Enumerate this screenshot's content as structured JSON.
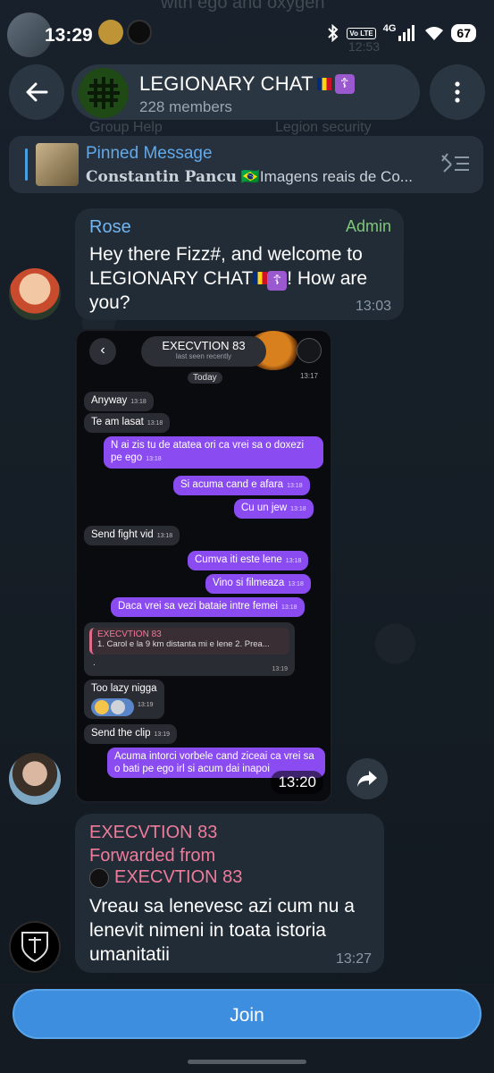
{
  "status_bar": {
    "time": "13:29",
    "battery": "67",
    "network": "4G",
    "volte": "Vo LTE"
  },
  "ghost": {
    "top_text": "with ego and oxygen",
    "top_time": "12:53",
    "group_help": "Group Help",
    "legion_security": "Legion security"
  },
  "header": {
    "title": "LEGIONARY CHAT",
    "members": "228 members",
    "cross_glyph": "☦"
  },
  "pinned": {
    "title": "Pinned Message",
    "author": "Constantin Pancu",
    "preview": "🇧🇷Imagens reais de Co..."
  },
  "messages": {
    "rose": {
      "sender": "Rose",
      "role": "Admin",
      "text_1": "Hey there Fizz#, and welcome to LEGIONARY CHAT",
      "text_2": "! How are you?",
      "time": "13:03"
    },
    "screenshot": {
      "time": "13:20",
      "inner": {
        "contact": "EXECVTION 83",
        "status": "last seen recently",
        "day": "Today",
        "top_time": "13:17",
        "msgs": [
          {
            "text": "Anyway",
            "time": "13:18"
          },
          {
            "text": "Te am lasat",
            "time": "13:18"
          },
          {
            "text": "N ai zis tu de atatea ori ca vrei sa o doxezi pe ego",
            "time": "13:18"
          },
          {
            "text": "Si acuma cand e afara",
            "time": "13:18"
          },
          {
            "text": "Cu un jew",
            "time": "13:18"
          },
          {
            "text": "Send fight vid",
            "time": "13:18"
          },
          {
            "text": "Cumva iti este lene",
            "time": "13:18"
          },
          {
            "text": "Vino si filmeaza",
            "time": "13:18"
          },
          {
            "text": "Daca vrei sa vezi bataie intre femei",
            "time": "13:18"
          },
          {
            "text": "Too lazy nigga",
            "time": "13:19"
          },
          {
            "text": "Send the clip",
            "time": "13:19"
          },
          {
            "text": "Acuma intorci vorbele cand ziceai ca vrei sa o bati pe ego irl si acum dai inapoi",
            "time": ""
          }
        ],
        "reply": {
          "name": "EXECVTION 83",
          "text": "1. Carol e la 9 km distanta mi e lene 2. Prea...",
          "body": ".",
          "time": "13:19"
        }
      }
    },
    "forwarded": {
      "sender": "EXECVTION 83",
      "label": "Forwarded from",
      "origin": "EXECVTION 83",
      "text": "Vreau sa lenevesc azi cum nu a lenevit nimeni in toata istoria umanitatii",
      "time": "13:27"
    }
  },
  "join_label": "Join",
  "colors": {
    "accent": "#3e8ee0",
    "background": "#141b22",
    "bubble": "#222c36",
    "admin": "#7ec67a",
    "forward": "#ef7b9b",
    "purple_bubble": "#8a4cf0"
  }
}
